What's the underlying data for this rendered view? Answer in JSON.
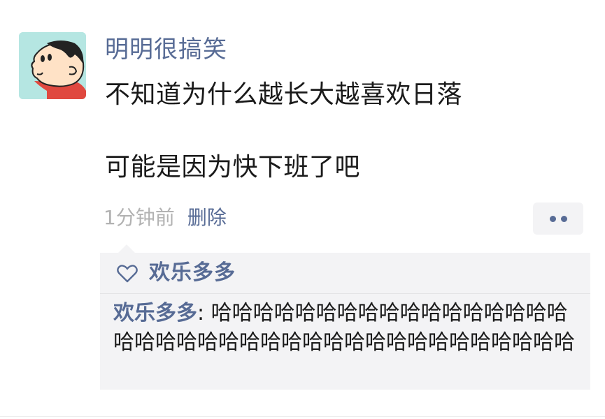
{
  "post": {
    "author": "明明很搞笑",
    "text_line1": "不知道为什么越长大越喜欢日落",
    "text_line2": "可能是因为快下班了吧",
    "time": "1分钟前",
    "delete_label": "删除",
    "more_icon": "more-dots-icon"
  },
  "likes": {
    "icon": "heart-outline-icon",
    "names": "欢乐多多"
  },
  "comments": [
    {
      "author": "欢乐多多",
      "separator": ": ",
      "text": "哈哈哈哈哈哈哈哈哈哈哈哈哈哈哈哈哈哈哈哈哈哈哈哈哈哈哈哈哈哈哈哈哈哈哈哈哈哈哈"
    }
  ],
  "colors": {
    "link": "#576b95",
    "text": "#1a1a1a",
    "muted": "#b2b2b2",
    "panel": "#f3f3f5"
  }
}
